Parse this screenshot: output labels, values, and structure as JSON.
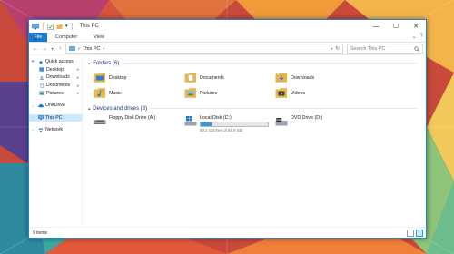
{
  "window": {
    "title": "This PC"
  },
  "ribbon": {
    "file_label": "File",
    "tabs": [
      "Computer",
      "View"
    ]
  },
  "address": {
    "path_root": "This PC",
    "separator": "›",
    "search_placeholder": "Search This PC"
  },
  "nav": {
    "quick_access": "Quick access",
    "pinned": [
      "Desktop",
      "Downloads",
      "Documents",
      "Pictures"
    ],
    "onedrive": "OneDrive",
    "this_pc": "This PC",
    "network": "Network"
  },
  "folders_section": {
    "header": "Folders (6)",
    "items": [
      "Desktop",
      "Documents",
      "Downloads",
      "Music",
      "Pictures",
      "Videos"
    ]
  },
  "drives_section": {
    "header": "Devices and drives (3)",
    "floppy": "Floppy Disk Drive (A:)",
    "local": {
      "name": "Local Disk (C:)",
      "free_text": "50.2 GB free of 59.9 GB",
      "used_fraction": 0.16
    },
    "dvd": "DVD Drive (D:)"
  },
  "status": {
    "items_text": "9 items"
  },
  "colors": {
    "accent": "#1979ca",
    "selection": "#cce8ff",
    "folder": "#e8b64c",
    "header_text": "#1e3287"
  }
}
